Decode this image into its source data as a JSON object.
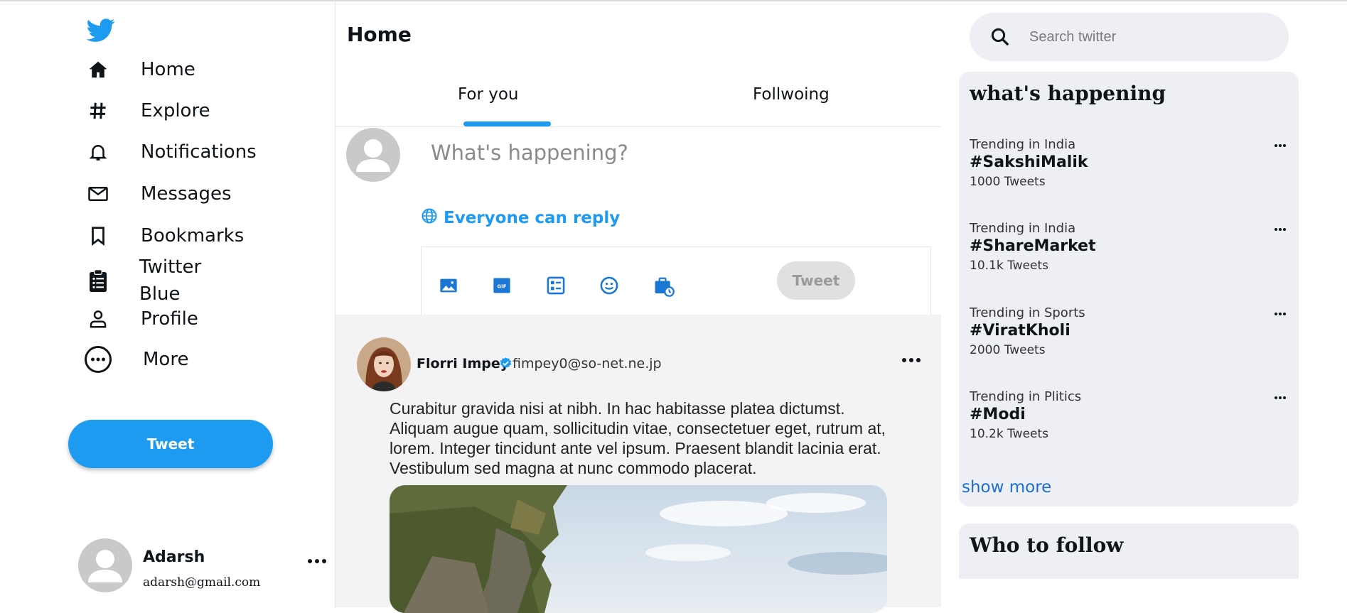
{
  "nav": {
    "items": [
      {
        "label": "Home",
        "icon": "home-icon"
      },
      {
        "label": "Explore",
        "icon": "hashtag-icon"
      },
      {
        "label": "Notifications",
        "icon": "bell-icon"
      },
      {
        "label": "Messages",
        "icon": "mail-icon"
      },
      {
        "label": "Bookmarks",
        "icon": "bookmark-icon"
      },
      {
        "label": "Twitter Blue",
        "icon": "clipboard-icon"
      },
      {
        "label": "Profile",
        "icon": "person-icon"
      },
      {
        "label": "More",
        "icon": "more-circle-icon"
      }
    ],
    "tweet_label": "Tweet"
  },
  "account": {
    "name": "Adarsh",
    "email": "adarsh@gmail.com"
  },
  "main": {
    "title": "Home",
    "tabs": [
      {
        "label": "For you",
        "active": true
      },
      {
        "label": "Follwoing",
        "active": false
      }
    ],
    "compose": {
      "placeholder": "What's happening?",
      "reply_label": "Everyone can reply",
      "tweet_label": "Tweet",
      "tools": [
        "image-icon",
        "gif-icon",
        "poll-icon",
        "emoji-icon",
        "schedule-icon"
      ]
    },
    "post": {
      "name": "Florri Impey",
      "handle": "fimpey0@so-net.ne.jp",
      "text": "Curabitur gravida nisi at nibh. In hac habitasse platea dictumst. Aliquam augue quam, sollicitudin vitae, consectetuer eget, rutrum at, lorem. Integer tincidunt ante vel ipsum. Praesent blandit lacinia erat. Vestibulum sed magna at nunc commodo placerat."
    }
  },
  "right": {
    "search_placeholder": "Search twitter",
    "trends_title": "what's happening",
    "trends": [
      {
        "category": "Trending in India",
        "tag": "#SakshiMalik",
        "count": "1000 Tweets"
      },
      {
        "category": "Trending in India",
        "tag": "#ShareMarket",
        "count": "10.1k Tweets"
      },
      {
        "category": "Trending in Sports",
        "tag": "#ViratKholi",
        "count": "2000 Tweets"
      },
      {
        "category": "Trending in Plitics",
        "tag": "#Modi",
        "count": "10.2k Tweets"
      }
    ],
    "show_more": "show more",
    "follow_title": "Who to follow"
  },
  "colors": {
    "accent": "#1d9bf0",
    "panel_bg": "#eeeff4",
    "feed_bg": "#f3f3f3",
    "link": "#1a6fd1"
  }
}
